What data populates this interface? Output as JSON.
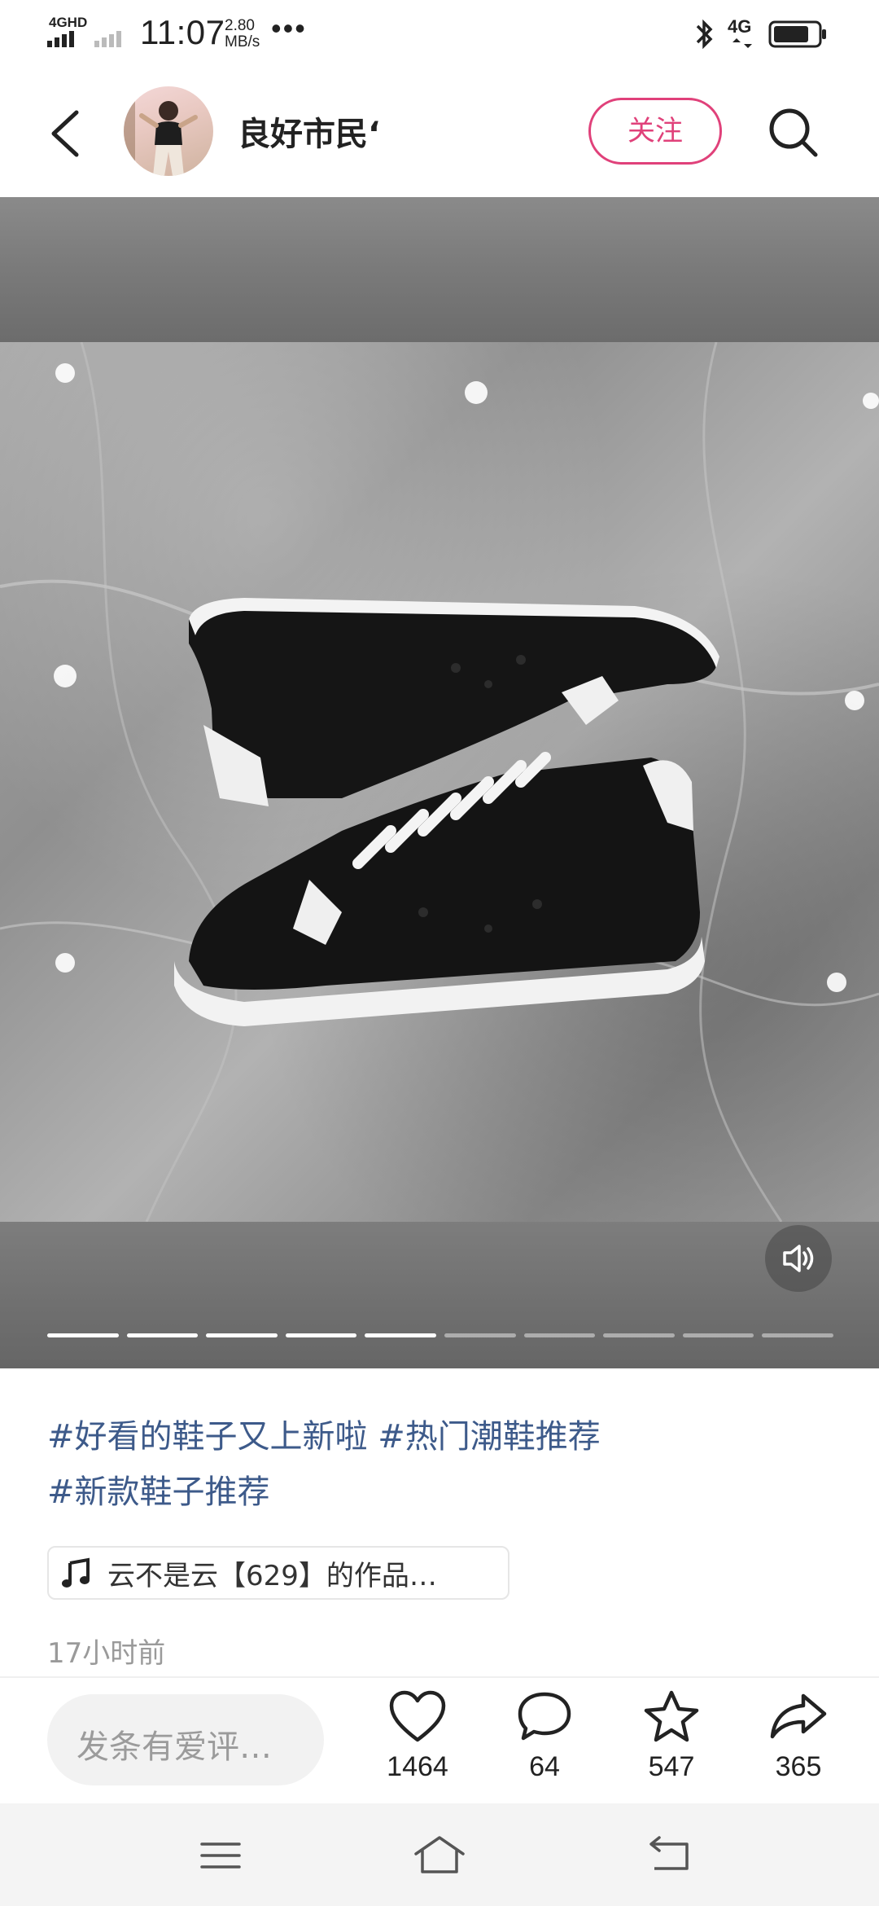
{
  "status_bar": {
    "network_type": "4GHD",
    "time": "11:07",
    "speed_value": "2.80",
    "speed_unit": "MB/s",
    "more": "•••",
    "right_network": "4G"
  },
  "header": {
    "username": "良好市民‘",
    "follow_label": "关注"
  },
  "media": {
    "slide_count": 10,
    "active_slides": 5
  },
  "post": {
    "caption_line1": "#好看的鞋子又上新啦 #热门潮鞋推荐",
    "caption_line2": "#新款鞋子推荐",
    "music": "云不是云【629】的作品…",
    "time_ago": "17小时前"
  },
  "actions": {
    "comment_placeholder": "发条有爱评…",
    "likes": "1464",
    "comments": "64",
    "favorites": "547",
    "shares": "365"
  },
  "colors": {
    "accent": "#e0417a",
    "hashtag": "#3d5a8a"
  }
}
